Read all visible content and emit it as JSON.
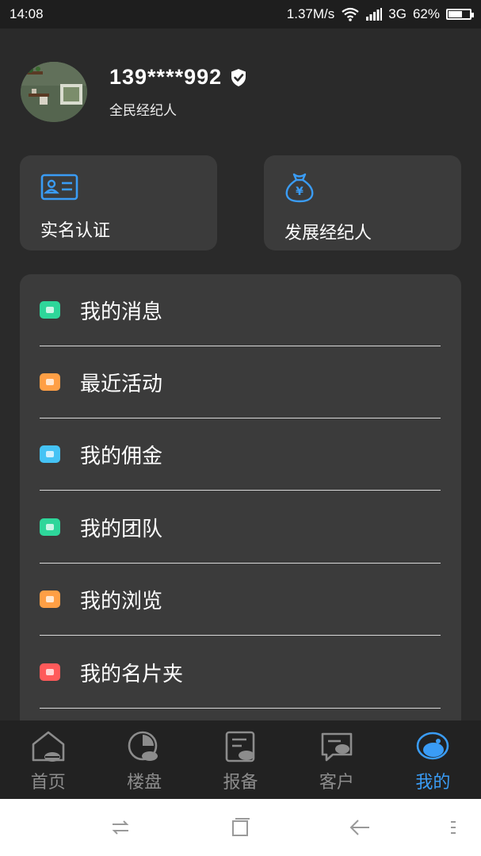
{
  "status_bar": {
    "time": "14:08",
    "network_speed": "1.37M/s",
    "network_type": "3G",
    "battery": "62%",
    "battery_level": 0.62
  },
  "profile": {
    "username": "139****992",
    "role": "全民经纪人",
    "verified_icon": "shield-check-icon"
  },
  "cards": [
    {
      "label": "实名认证",
      "icon": "id-card-icon"
    },
    {
      "label": "发展经纪人",
      "icon": "money-bag-icon"
    }
  ],
  "menu": [
    {
      "label": "我的消息",
      "icon": "message-icon",
      "color": "#2ed69a"
    },
    {
      "label": "最近活动",
      "icon": "calendar-icon",
      "color": "#ff9f45"
    },
    {
      "label": "我的佣金",
      "icon": "person-icon",
      "color": "#45c3f5"
    },
    {
      "label": "我的团队",
      "icon": "team-icon",
      "color": "#2ed69a"
    },
    {
      "label": "我的浏览",
      "icon": "eye-icon",
      "color": "#ff9f45"
    },
    {
      "label": "我的名片夹",
      "icon": "gift-icon",
      "color": "#ff5a5a"
    }
  ],
  "tabs": [
    {
      "label": "首页",
      "icon": "home-icon"
    },
    {
      "label": "楼盘",
      "icon": "pie-icon"
    },
    {
      "label": "报备",
      "icon": "report-icon"
    },
    {
      "label": "客户",
      "icon": "customer-icon"
    },
    {
      "label": "我的",
      "icon": "mine-icon",
      "active": true
    }
  ],
  "colors": {
    "accent": "#3a9cf5",
    "background": "#2a2a2a",
    "card": "#3b3b3b",
    "tab_inactive": "#8c8c8c"
  }
}
